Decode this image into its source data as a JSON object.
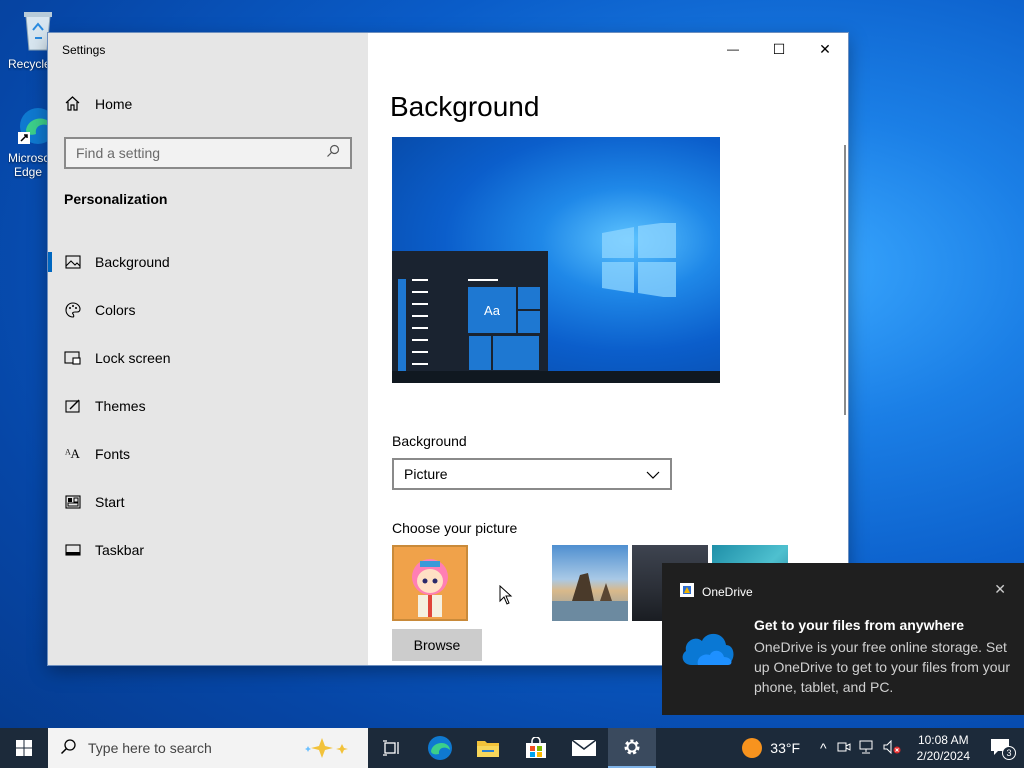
{
  "desktop": {
    "icons": [
      {
        "label": "Recycle Bin",
        "icon": "recycle-bin-icon"
      },
      {
        "label": "Microsoft Edge",
        "icon": "edge-icon"
      }
    ]
  },
  "window": {
    "title": "Settings",
    "controls": {
      "minimize": "—",
      "maximize": "☐",
      "close": "✕"
    }
  },
  "sidebar": {
    "home_label": "Home",
    "search_placeholder": "Find a setting",
    "section_title": "Personalization",
    "items": [
      {
        "label": "Background",
        "icon": "picture-icon",
        "active": true
      },
      {
        "label": "Colors",
        "icon": "palette-icon",
        "active": false
      },
      {
        "label": "Lock screen",
        "icon": "lock-screen-icon",
        "active": false
      },
      {
        "label": "Themes",
        "icon": "themes-icon",
        "active": false
      },
      {
        "label": "Fonts",
        "icon": "fonts-icon",
        "active": false
      },
      {
        "label": "Start",
        "icon": "start-icon",
        "active": false
      },
      {
        "label": "Taskbar",
        "icon": "taskbar-icon",
        "active": false
      }
    ]
  },
  "main": {
    "title": "Background",
    "preview_tile_text": "Aa",
    "background_label": "Background",
    "background_value": "Picture",
    "choose_label": "Choose your picture",
    "browse_label": "Browse"
  },
  "toast": {
    "app_name": "OneDrive",
    "title": "Get to your files from anywhere",
    "body": "OneDrive is your free online storage. Set up OneDrive to get to your files from your phone, tablet, and PC."
  },
  "taskbar": {
    "search_placeholder": "Type here to search",
    "weather": "33°F",
    "time": "10:08 AM",
    "date": "2/20/2024",
    "notification_count": "3"
  },
  "colors": {
    "accent": "#0067c0",
    "taskbar": "#1c2a3a",
    "toast_bg": "#1f1f1f"
  }
}
